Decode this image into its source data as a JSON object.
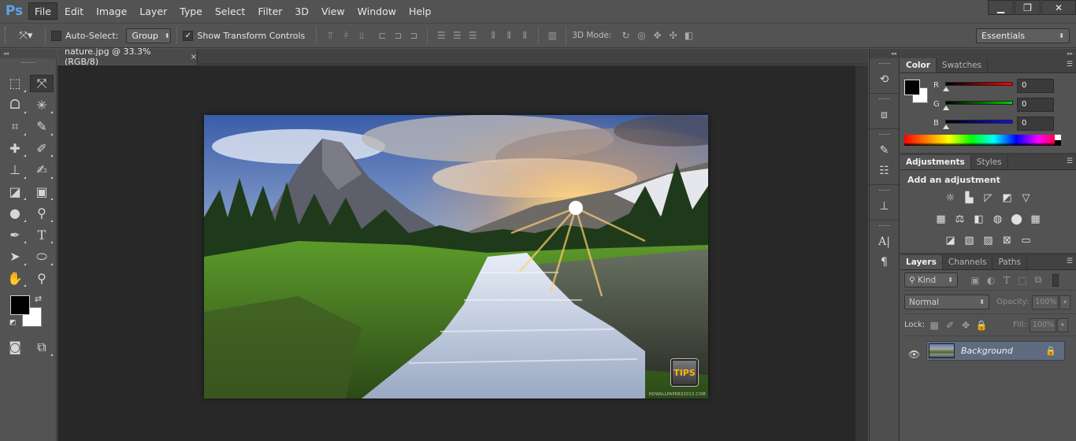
{
  "app": {
    "logo": "Ps"
  },
  "menu": [
    "File",
    "Edit",
    "Image",
    "Layer",
    "Type",
    "Select",
    "Filter",
    "3D",
    "View",
    "Window",
    "Help"
  ],
  "window_controls": {
    "minimize": "▁",
    "restore": "❐",
    "close": "✕"
  },
  "options_bar": {
    "auto_select_label": "Auto-Select:",
    "auto_select_checked": false,
    "auto_select_target": "Group",
    "show_transform_label": "Show Transform Controls",
    "show_transform_checked": true,
    "mode_3d_label": "3D Mode:",
    "workspace": "Essentials"
  },
  "document": {
    "tab_title": "nature.jpg @ 33.3% (RGB/8)",
    "tab_close": "×",
    "badge_text": "TIPS",
    "watermark": "HDWALLPAPERS2013.COM"
  },
  "color_panel": {
    "tabs": [
      "Color",
      "Swatches"
    ],
    "channels": [
      {
        "label": "R",
        "value": "0",
        "color": "#ff0000"
      },
      {
        "label": "G",
        "value": "0",
        "color": "#00d000"
      },
      {
        "label": "B",
        "value": "0",
        "color": "#1010ff"
      }
    ]
  },
  "adjustments_panel": {
    "tabs": [
      "Adjustments",
      "Styles"
    ],
    "title": "Add an adjustment"
  },
  "layers_panel": {
    "tabs": [
      "Layers",
      "Channels",
      "Paths"
    ],
    "filter_kind": "Kind",
    "blend_mode": "Normal",
    "opacity_label": "Opacity:",
    "opacity_value": "100%",
    "lock_label": "Lock:",
    "fill_label": "Fill:",
    "fill_value": "100%",
    "layers": [
      {
        "name": "Background",
        "visible": true,
        "locked": true
      }
    ]
  },
  "colors": {
    "foreground": "#000000",
    "background": "#ffffff",
    "ui_panel": "#535353",
    "canvas_bg": "#282828",
    "selected_layer": "#5f6c80"
  }
}
